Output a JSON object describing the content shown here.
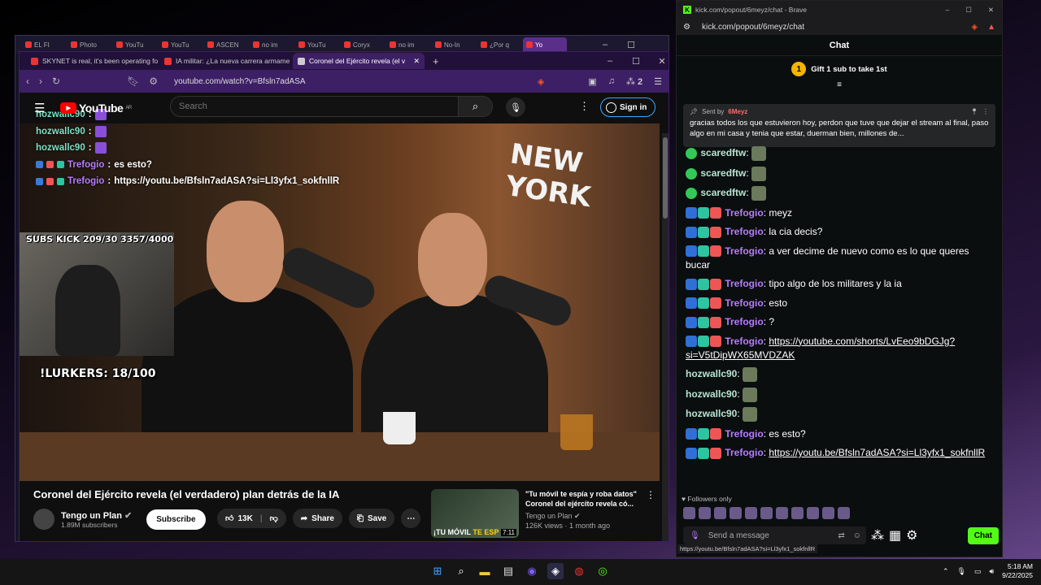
{
  "back_window": {
    "tabs": [
      "EL FI",
      "Photo",
      "YouTu",
      "YouTu",
      "ASCEN",
      "no im",
      "YouTu",
      "Coryx",
      "no im",
      "No-In",
      "¿Por q",
      "Yo"
    ]
  },
  "front_window": {
    "tabs": [
      {
        "label": "SKYNET is real, it's been operating fo"
      },
      {
        "label": "IA militar: ¿La nueva carrera armame"
      },
      {
        "label": "Coronel del Ejército revela (el v"
      }
    ],
    "url": "youtube.com/watch?v=Bfsln7adASA",
    "extensions_count": "2"
  },
  "youtube": {
    "logo": "YouTube",
    "region": "AR",
    "search_placeholder": "Search",
    "signin": "Sign in",
    "overlay_chat": [
      {
        "user": "hozwallc90",
        "text": ""
      },
      {
        "user": "hozwallc90",
        "text": ""
      },
      {
        "user": "hozwallc90",
        "text": ""
      },
      {
        "user": "Trefogio",
        "text": "es esto?"
      },
      {
        "user": "Trefogio",
        "text": "https://youtu.be/Bfsln7adASA?si=Ll3yfx1_sokfnllR"
      }
    ],
    "cam_left": "SUBS KICK 209/30",
    "cam_right": "3357/4000",
    "lurkers": "!LURKERS: 18/100",
    "video_wall_text": "NEW YORK",
    "title": "Coronel del Ejército revela (el verdadero) plan detrás de la IA",
    "channel": "Tengo un Plan",
    "subscribers": "1.89M subscribers",
    "subscribe": "Subscribe",
    "likes": "13K",
    "share": "Share",
    "save": "Save",
    "recommended": {
      "caption_a": "¡TU MÓVIL ",
      "caption_b": "TE ESP",
      "duration": "7:11",
      "title": "\"Tu móvil te espía y roba datos\" Coronel del ejército revela có...",
      "channel": "Tengo un Plan",
      "stats": "126K views · 1 month ago"
    }
  },
  "kick": {
    "window_title": "kick.com/popout/6meyz/chat - Brave",
    "url": "kick.com/popout/6meyz/chat",
    "header": "Chat",
    "gift_count": "1",
    "gift_text": "Gift 1 sub to take 1st",
    "pinned": {
      "sent_by": "Sent by",
      "author": "6Meyz",
      "message": "gracias todos los que estuvieron hoy, perdon que tuve que dejar el stream al final, paso algo en mi casa y tenia que estar, duerman bien, millones de..."
    },
    "messages": [
      {
        "user": "scaredftw",
        "text": "",
        "color": "grn"
      },
      {
        "user": "scaredftw",
        "text": "",
        "color": "grn"
      },
      {
        "user": "scaredftw",
        "text": "",
        "color": "grn"
      },
      {
        "user": "Trefogio",
        "text": "meyz",
        "color": "pur"
      },
      {
        "user": "Trefogio",
        "text": "la cia decis?",
        "color": "pur"
      },
      {
        "user": "Trefogio",
        "text": "a ver decime de nuevo como es lo que queres bucar",
        "color": "pur"
      },
      {
        "user": "Trefogio",
        "text": "tipo algo de los militares y la ia",
        "color": "pur"
      },
      {
        "user": "Trefogio",
        "text": "esto",
        "color": "pur"
      },
      {
        "user": "Trefogio",
        "text": "?",
        "color": "pur"
      },
      {
        "user": "Trefogio",
        "text": "https://youtube.com/shorts/LvEeo9bDGJg?si=V5tDipWX65MVDZAK",
        "color": "pur",
        "link": true
      },
      {
        "user": "hozwallc90",
        "text": "",
        "color": "grn"
      },
      {
        "user": "hozwallc90",
        "text": "",
        "color": "grn"
      },
      {
        "user": "hozwallc90",
        "text": "",
        "color": "grn"
      },
      {
        "user": "Trefogio",
        "text": "es esto?",
        "color": "pur"
      },
      {
        "user": "Trefogio",
        "text": "https://youtu.be/Bfsln7adASA?si=Ll3yfx1_sokfnllR",
        "color": "pur",
        "link": true
      }
    ],
    "followers_only": "Followers only",
    "send_placeholder": "Send a message",
    "chat_button": "Chat",
    "status_url": "https://youtu.be/Bfsln7adASA?si=Ll3yfx1_sokfnllR"
  },
  "taskbar": {
    "time": "5:18 AM",
    "date": "9/22/2025"
  },
  "colors": {
    "kick_green": "#53fc18",
    "brave_purple": "#3d1f66",
    "youtube_red": "#ff0000"
  }
}
